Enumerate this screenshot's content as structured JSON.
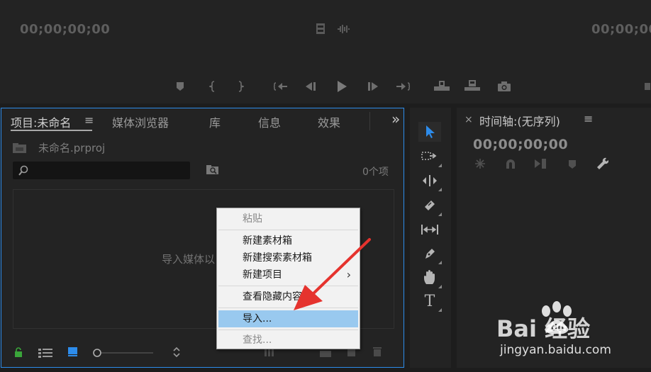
{
  "source_monitor": {
    "timecode_left": "00;00;00;00",
    "timecode_right": "00;00;00;00",
    "controls": [
      "marker-icon",
      "mark-in-icon",
      "mark-out-icon",
      "go-to-in-icon",
      "step-back-icon",
      "play-icon",
      "step-forward-icon",
      "go-to-out-icon",
      "insert-icon",
      "overwrite-icon",
      "camera-icon"
    ]
  },
  "project_panel": {
    "tabs": [
      {
        "label": "项目:未命名",
        "active": true
      },
      {
        "label": "媒体浏览器",
        "active": false
      },
      {
        "label": "库",
        "active": false
      },
      {
        "label": "信息",
        "active": false
      },
      {
        "label": "效果",
        "active": false
      }
    ],
    "menu_glyph": "≡",
    "overflow_glyph": "»",
    "project_file": "未命名.prproj",
    "search_placeholder": "",
    "item_count": "0个项",
    "dropzone_hint": "导入媒体以",
    "footer_icons": [
      "lock-icon",
      "list-view-icon",
      "icon-view-icon",
      "zoom-slider",
      "sort-icon"
    ]
  },
  "context_menu": {
    "items": [
      {
        "label": "粘贴",
        "disabled": true
      },
      {
        "label": "新建素材箱",
        "disabled": false
      },
      {
        "label": "新建搜索素材箱",
        "disabled": false
      },
      {
        "label": "新建项目",
        "disabled": false,
        "submenu": true
      },
      {
        "label": "查看隐藏内容",
        "disabled": false
      },
      {
        "label": "导入...",
        "disabled": false,
        "highlighted": true
      },
      {
        "label": "查找...",
        "disabled": true
      }
    ],
    "submenu_arrow": "›"
  },
  "tools_panel": {
    "tools": [
      "selection-tool",
      "track-select-tool",
      "ripple-edit-tool",
      "razor-tool",
      "slip-tool",
      "pen-tool",
      "hand-tool",
      "type-tool"
    ],
    "type_glyph": "T"
  },
  "timeline_panel": {
    "close_glyph": "×",
    "title": "时间轴:(无序列)",
    "menu_glyph": "≡",
    "timecode": "00;00;00;00"
  },
  "colors": {
    "accent_blue": "#2d8ceb",
    "highlight": "#99c9ef",
    "arrow_red": "#e5332e",
    "lock_green": "#3aa53a"
  },
  "watermark": {
    "brand": "Bai  经验",
    "url": "jingyan.baidu.com"
  }
}
